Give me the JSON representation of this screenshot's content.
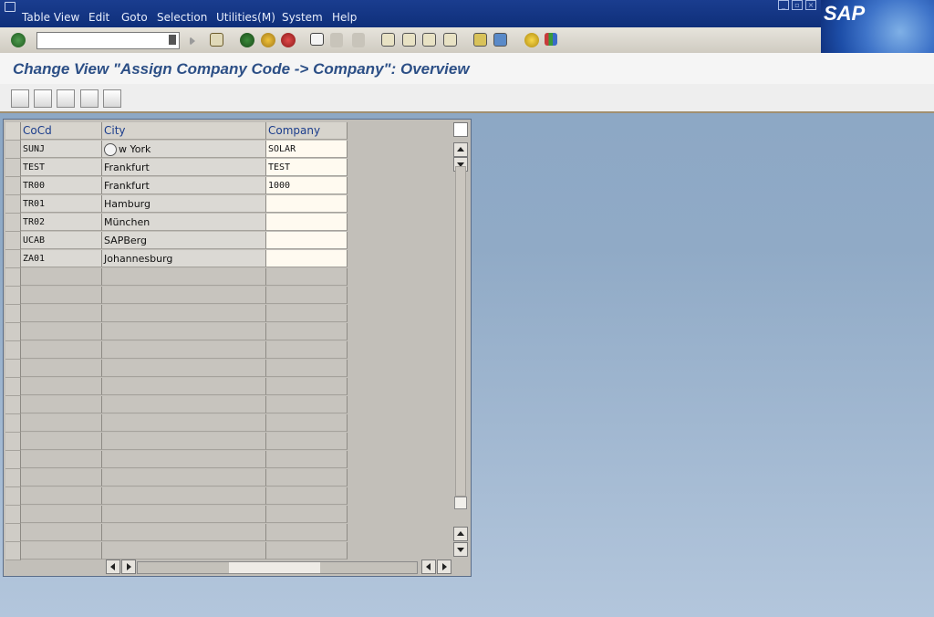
{
  "menu": [
    "Table View",
    "Edit",
    "Goto",
    "Selection",
    "Utilities(M)",
    "System",
    "Help"
  ],
  "brand": "SAP",
  "command_field": {
    "value": "",
    "placeholder": ""
  },
  "title": "Change View \"Assign Company Code -> Company\": Overview",
  "table": {
    "headers": {
      "cocd": "CoCd",
      "city": "City",
      "company": "Company"
    },
    "rows": [
      {
        "cocd": "SUNJ",
        "city": "w York",
        "company": "SOLAR"
      },
      {
        "cocd": "TEST",
        "city": "Frankfurt",
        "company": "TEST"
      },
      {
        "cocd": "TR00",
        "city": "Frankfurt",
        "company": "1000"
      },
      {
        "cocd": "TR01",
        "city": "Hamburg",
        "company": ""
      },
      {
        "cocd": "TR02",
        "city": "München",
        "company": ""
      },
      {
        "cocd": "UCAB",
        "city": "SAPBerg",
        "company": ""
      },
      {
        "cocd": "ZA01",
        "city": "Johannesburg",
        "company": ""
      }
    ],
    "empty_rows": 16
  },
  "icons": {
    "toolbar": [
      "enter-icon",
      "save-icon",
      "back-icon",
      "exit-icon",
      "cancel-icon",
      "print-icon",
      "find-icon",
      "find-next-icon",
      "first-page-icon",
      "previous-page-icon",
      "next-page-icon",
      "last-page-icon",
      "create-session-icon",
      "shortcut-icon",
      "help-icon",
      "layout-icon"
    ],
    "app_toolbar": [
      "display-change-icon",
      "undo-change-icon",
      "select-all-icon",
      "select-block-icon",
      "deselect-all-icon"
    ]
  },
  "colors": {
    "accent": "#2c4f86",
    "menubar": "#0f2f7a",
    "header_text": "#1b3d8c"
  }
}
